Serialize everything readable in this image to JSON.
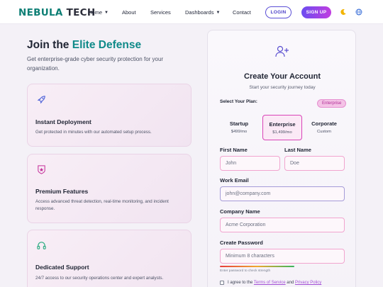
{
  "nav": {
    "logo_part1": "NEBULA",
    "logo_part2": "TECH",
    "links": [
      {
        "label": "Home",
        "dropdown": true
      },
      {
        "label": "About",
        "dropdown": false
      },
      {
        "label": "Services",
        "dropdown": false
      },
      {
        "label": "Dashboards",
        "dropdown": true
      },
      {
        "label": "Contact",
        "dropdown": false
      }
    ],
    "login": "LOGIN",
    "signup": "SIGN UP",
    "icons": [
      "moon-icon",
      "globe-icon"
    ]
  },
  "hero": {
    "title_plain": "Join the",
    "title_accent": "Elite Defense",
    "subtitle": "Get enterprise-grade cyber security protection for your organization."
  },
  "features": [
    {
      "icon": "rocket-icon",
      "title": "Instant Deployment",
      "desc": "Get protected in minutes with our automated setup process."
    },
    {
      "icon": "star-shield-icon",
      "title": "Premium Features",
      "desc": "Access advanced threat detection, real-time monitoring, and incident response."
    },
    {
      "icon": "headset-icon",
      "title": "Dedicated Support",
      "desc": "24/7 access to our security operations center and expert analysts."
    }
  ],
  "form": {
    "title": "Create Your Account",
    "subtitle": "Start your security journey today",
    "plan_label": "Select Your Plan:",
    "plan_badge": "Enterprise",
    "plans": [
      {
        "name": "Startup",
        "price": "$499/mo",
        "selected": false
      },
      {
        "name": "Enterprise",
        "price": "$1,499/mo",
        "selected": true
      },
      {
        "name": "Corporate",
        "price": "Custom",
        "selected": false
      }
    ],
    "first_name_label": "First Name",
    "first_name_placeholder": "John",
    "last_name_label": "Last Name",
    "last_name_placeholder": "Doe",
    "email_label": "Work Email",
    "email_placeholder": "john@company.com",
    "company_label": "Company Name",
    "company_placeholder": "Acme Corporation",
    "password_label": "Create Password",
    "password_placeholder": "Minimum 8 characters",
    "strength_hint": "Enter password to check strength",
    "terms_prefix": "I agree to the",
    "terms_link": "Terms of Service",
    "terms_and": "and",
    "privacy_link": "Privacy Policy"
  },
  "colors": {
    "brand_teal": "#0e7f75",
    "accent_purple": "#6b4cf0",
    "accent_pink": "#d944b8"
  }
}
